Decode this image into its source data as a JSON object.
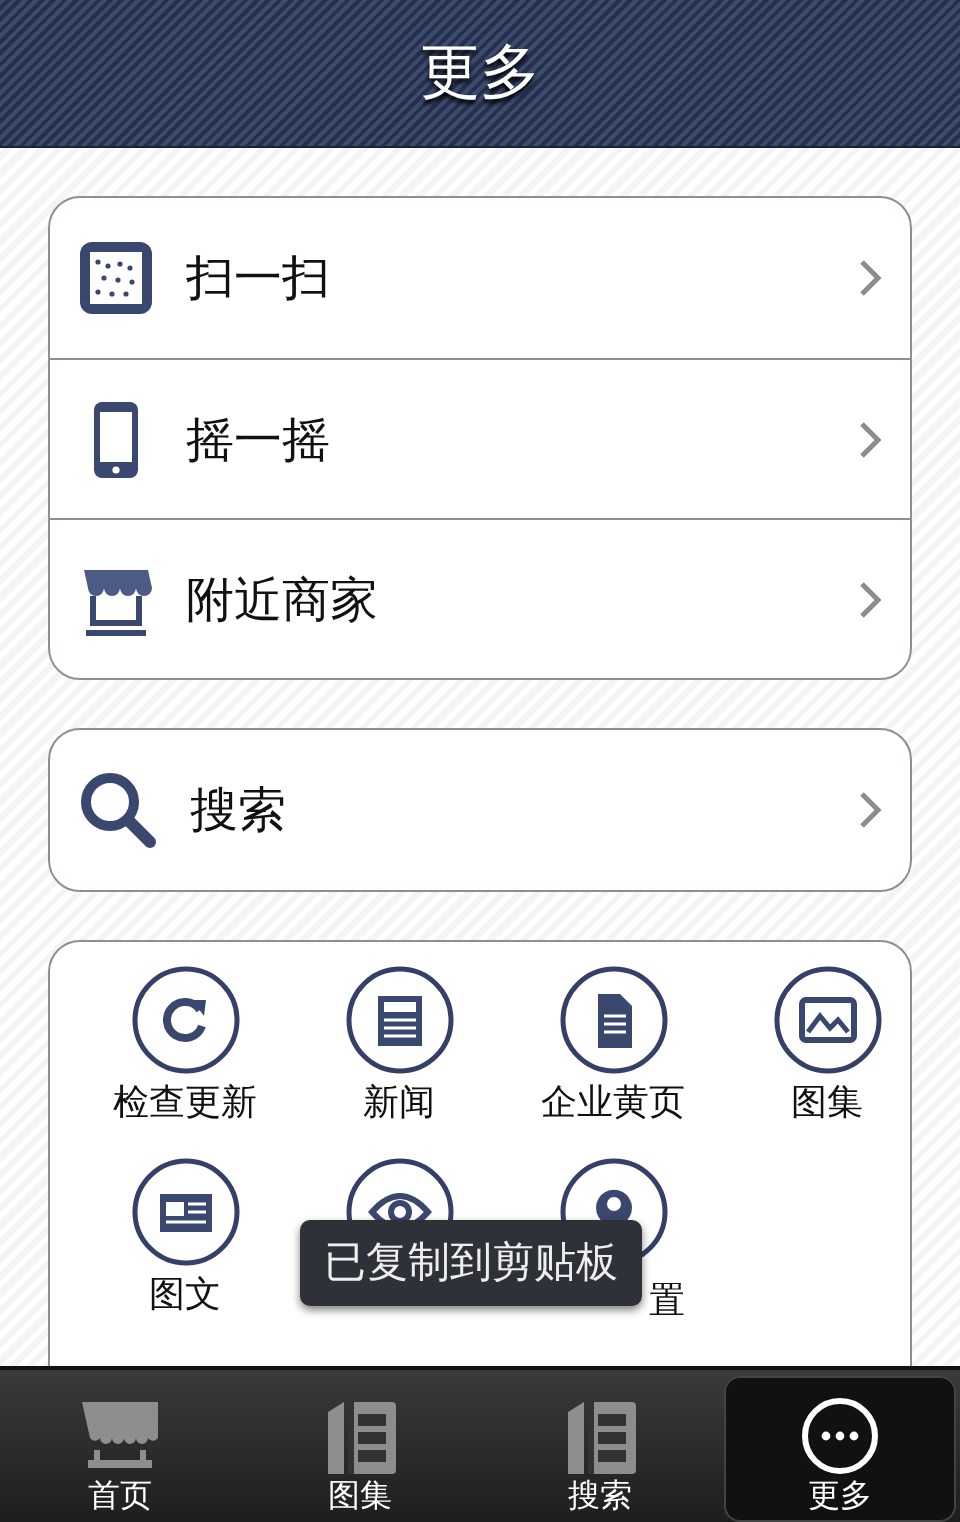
{
  "header": {
    "title": "更多"
  },
  "menu_groups": [
    {
      "items": [
        {
          "label": "扫一扫",
          "kind": "scan"
        },
        {
          "label": "摇一摇",
          "kind": "phone"
        },
        {
          "label": "附近商家",
          "kind": "shop"
        }
      ]
    },
    {
      "items": [
        {
          "label": "搜索",
          "kind": "search"
        }
      ]
    }
  ],
  "grid": [
    {
      "label": "检查更新",
      "kind": "refresh"
    },
    {
      "label": "新闻",
      "kind": "news"
    },
    {
      "label": "企业黄页",
      "kind": "document"
    },
    {
      "label": "图集",
      "kind": "image"
    },
    {
      "label": "图文",
      "kind": "article"
    },
    {
      "kind": "eye"
    },
    {
      "label": "置",
      "kind": "pin"
    }
  ],
  "toast": {
    "text": "已复制到剪贴板"
  },
  "tab_bar": [
    {
      "label": "首页",
      "kind": "awning",
      "selected": false
    },
    {
      "label": "图集",
      "kind": "book",
      "selected": false
    },
    {
      "label": "搜索",
      "kind": "book",
      "selected": false
    },
    {
      "label": "更多",
      "kind": "dots",
      "selected": true
    }
  ]
}
